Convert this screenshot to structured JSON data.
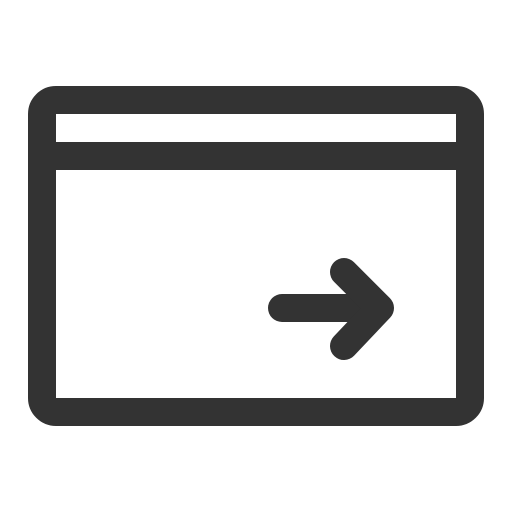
{
  "icon": {
    "name": "browser-window-arrow-right-icon",
    "parts": [
      "window-frame",
      "title-bar-divider",
      "arrow-right"
    ],
    "stroke_color": "#333333",
    "background_color": "#ffffff"
  }
}
